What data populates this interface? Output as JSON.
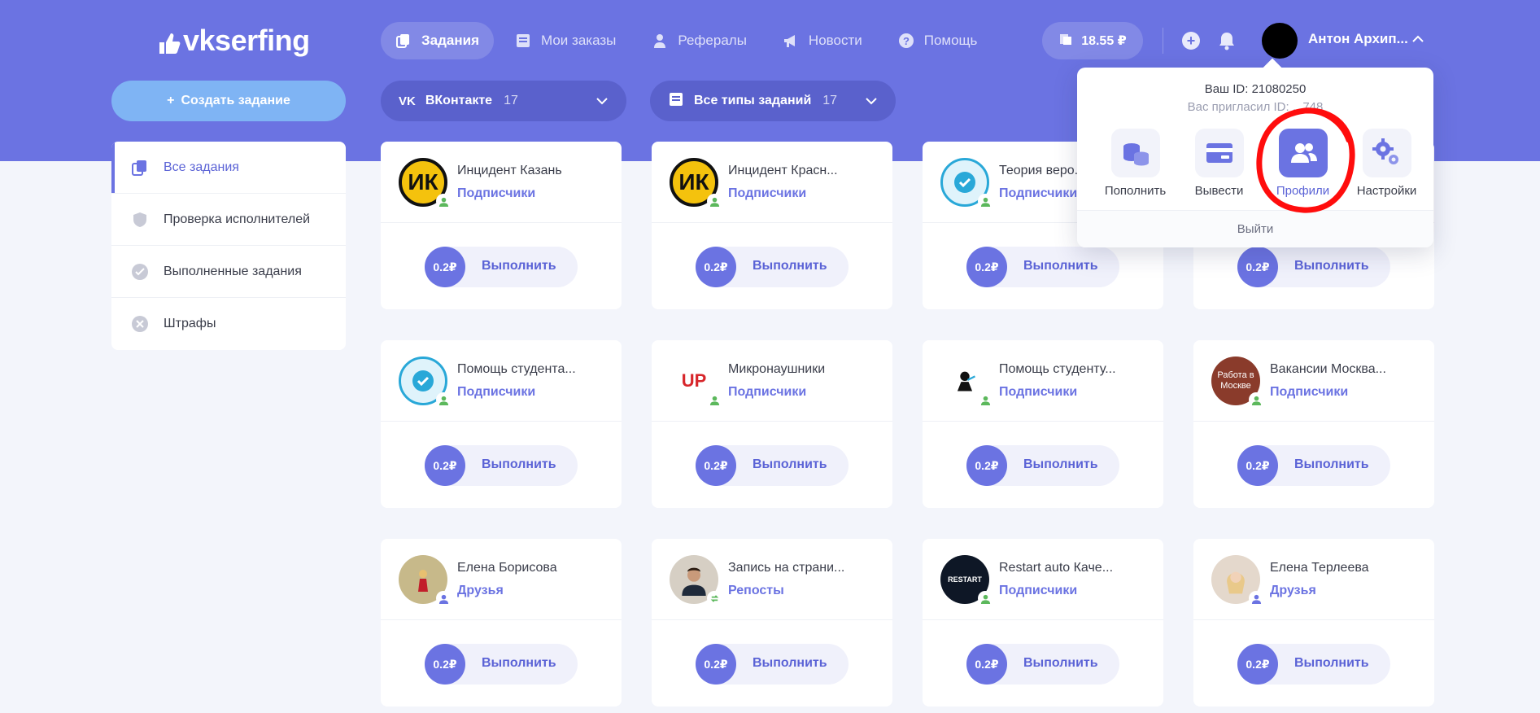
{
  "brand": {
    "logo_text": "vkserfing",
    "primary": "#6b73e2",
    "accent": "#7fb4f4"
  },
  "nav": {
    "items": [
      {
        "label": "Задания",
        "icon": "tasks-icon",
        "active": true
      },
      {
        "label": "Мои заказы",
        "icon": "orders-icon",
        "active": false
      },
      {
        "label": "Рефералы",
        "icon": "referrals-icon",
        "active": false
      },
      {
        "label": "Новости",
        "icon": "megaphone-icon",
        "active": false
      },
      {
        "label": "Помощь",
        "icon": "help-icon",
        "active": false
      }
    ]
  },
  "header": {
    "balance": "18.55 ₽",
    "user_name": "Антон Архип...",
    "plus_icon": "plus-icon",
    "bell_icon": "bell-icon"
  },
  "left": {
    "create_button": "Создать задание",
    "sidebar": [
      {
        "label": "Все задания",
        "icon": "copy-icon",
        "active": true
      },
      {
        "label": "Проверка исполнителей",
        "icon": "shield-icon",
        "active": false
      },
      {
        "label": "Выполненные задания",
        "icon": "check-circle-icon",
        "active": false
      },
      {
        "label": "Штрафы",
        "icon": "x-circle-icon",
        "active": false
      }
    ]
  },
  "filters": [
    {
      "label": "ВКонтакте",
      "count": "17",
      "icon": "vk-icon"
    },
    {
      "label": "Все типы заданий",
      "count": "17",
      "icon": "doc-icon"
    }
  ],
  "tasks": [
    {
      "title": "Инцидент Казань",
      "type": "Подписчики",
      "price": "0.2₽",
      "action": "Выполнить"
    },
    {
      "title": "Инцидент Красн...",
      "type": "Подписчики",
      "price": "0.2₽",
      "action": "Выполнить"
    },
    {
      "title": "Теория веро...",
      "type": "Подписчики",
      "price": "0.2₽",
      "action": "Выполнить"
    },
    {
      "title": "",
      "type": "",
      "price": "0.2₽",
      "action": "Выполнить"
    },
    {
      "title": "Помощь студента...",
      "type": "Подписчики",
      "price": "0.2₽",
      "action": "Выполнить"
    },
    {
      "title": "Микронаушники",
      "type": "Подписчики",
      "price": "0.2₽",
      "action": "Выполнить"
    },
    {
      "title": "Помощь студенту...",
      "type": "Подписчики",
      "price": "0.2₽",
      "action": "Выполнить"
    },
    {
      "title": "Вакансии Москва...",
      "type": "Подписчики",
      "price": "0.2₽",
      "action": "Выполнить"
    },
    {
      "title": "Елена Борисова",
      "type": "Друзья",
      "price": "0.2₽",
      "action": "Выполнить"
    },
    {
      "title": "Запись на страни...",
      "type": "Репосты",
      "price": "0.2₽",
      "action": "Выполнить"
    },
    {
      "title": "Restart auto Каче...",
      "type": "Подписчики",
      "price": "0.2₽",
      "action": "Выполнить"
    },
    {
      "title": "Елена Терлеева",
      "type": "Друзья",
      "price": "0.2₽",
      "action": "Выполнить"
    }
  ],
  "avatar_text": {
    "ik": "ИК",
    "up": "UP",
    "jobs": "Работа в Москве",
    "restart": "RESTART"
  },
  "popover": {
    "id_text": "Ваш ID: 21080250",
    "invited_text": "Вас пригласил ID: ...748",
    "actions": [
      {
        "label": "Пополнить",
        "icon": "coins-icon",
        "active": false
      },
      {
        "label": "Вывести",
        "icon": "card-icon",
        "active": false
      },
      {
        "label": "Профили",
        "icon": "users-icon",
        "active": true
      },
      {
        "label": "Настройки",
        "icon": "gears-icon",
        "active": false
      }
    ],
    "logout": "Выйти"
  }
}
